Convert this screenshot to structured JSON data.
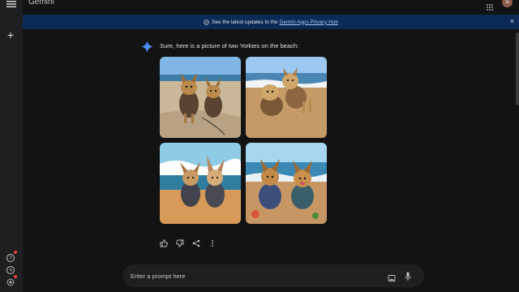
{
  "app": {
    "title": "Gemini",
    "avatar_initial": "S"
  },
  "banner": {
    "text": "See the latest updates to the",
    "link_text": "Gemini Apps Privacy Hub"
  },
  "response": {
    "text": "Sure, here is a picture of two Yorkies on the beach:"
  },
  "composer": {
    "placeholder": "Enter a prompt here"
  },
  "colors": {
    "background": "#131314",
    "sidebar": "#1e1f20",
    "banner": "#0b2a55",
    "accent": "#4c8df6"
  },
  "icons": {
    "sidebar": [
      "menu-icon",
      "plus-icon",
      "help-icon",
      "history-icon",
      "settings-icon"
    ],
    "actions": [
      "thumbs-up-icon",
      "thumbs-down-icon",
      "share-icon",
      "more-vert-icon"
    ],
    "composer": [
      "image-upload-icon",
      "mic-icon"
    ]
  },
  "images": [
    {
      "alt": "Two Yorkies sitting on sand"
    },
    {
      "alt": "Two Yorkies standing on beach"
    },
    {
      "alt": "Two Yorkies with waves behind"
    },
    {
      "alt": "Two Yorkies painted style on beach"
    }
  ]
}
